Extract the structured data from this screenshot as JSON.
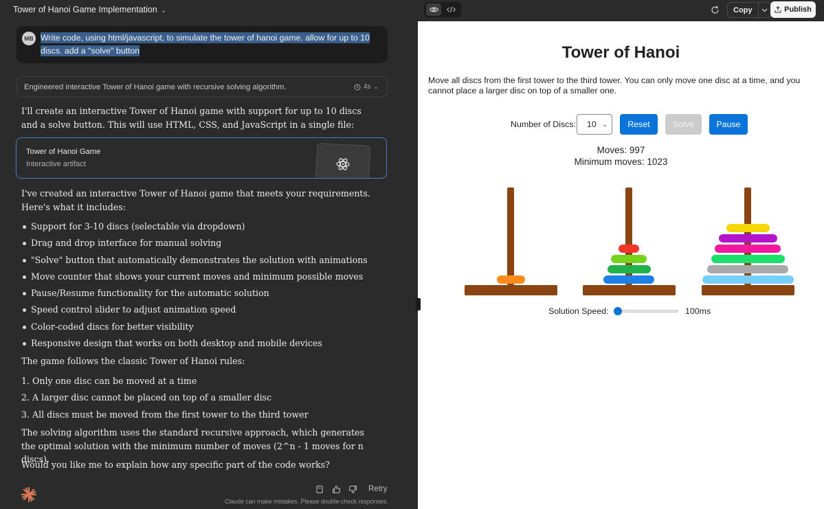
{
  "chat": {
    "title": "Tower of Hanoi Game Implementation",
    "user": {
      "initials": "MB",
      "message": "Write code, using html/javascript, to simulate the tower of hanoi game. allow for up to 10 discs. add a \"solve\" button"
    },
    "thinking": {
      "summary": "Engineered interactive Tower of Hanoi game with recursive solving algorithm.",
      "duration": "4s"
    },
    "intro": "I'll create an interactive Tower of Hanoi game with support for up to 10 discs and a solve button. This will use HTML, CSS, and JavaScript in a single file:",
    "artifact": {
      "title": "Tower of Hanoi Game",
      "subtitle": "Interactive artifact",
      "icon": "atom-icon"
    },
    "created": "I've created an interactive Tower of Hanoi game that meets your requirements. Here's what it includes:",
    "features": [
      "Support for 3-10 discs (selectable via dropdown)",
      "Drag and drop interface for manual solving",
      "\"Solve\" button that automatically demonstrates the solution with animations",
      "Move counter that shows your current moves and minimum possible moves",
      "Pause/Resume functionality for the automatic solution",
      "Speed control slider to adjust animation speed",
      "Color-coded discs for better visibility",
      "Responsive design that works on both desktop and mobile devices"
    ],
    "rules_intro": "The game follows the classic Tower of Hanoi rules:",
    "rules": [
      "1. Only one disc can be moved at a time",
      "2. A larger disc cannot be placed on top of a smaller disc",
      "3. All discs must be moved from the first tower to the third tower"
    ],
    "algorithm": "The solving algorithm uses the standard recursive approach, which generates the optimal solution with the minimum number of moves (2^n - 1 moves for n discs).",
    "question": "Would you like me to explain how any specific part of the code works?",
    "actions": {
      "retry": "Retry"
    },
    "disclaimer": "Claude can make mistakes. Please double-check responses."
  },
  "toolbar": {
    "copy": "Copy",
    "publish": "Publish"
  },
  "game": {
    "title": "Tower of Hanoi",
    "description": "Move all discs from the first tower to the third tower. You can only move one disc at a time, and you cannot place a larger disc on top of a smaller one.",
    "disc_label": "Number of Discs:",
    "disc_count": "10",
    "reset": "Reset",
    "solve": "Solve",
    "pause": "Pause",
    "moves_text": "Moves: 997",
    "min_moves_text": "Minimum moves: 1023",
    "speed_label": "Solution Speed:",
    "speed_value": "100ms",
    "speed_fraction": 0,
    "towers": [
      {
        "discs": [
          {
            "size": 2,
            "color": "#ff8c1a"
          }
        ]
      },
      {
        "discs": [
          {
            "size": 5,
            "color": "#1e80e6"
          },
          {
            "size": 4,
            "color": "#22b24c"
          },
          {
            "size": 3,
            "color": "#76d21b"
          },
          {
            "size": 1,
            "color": "#f2352b"
          }
        ]
      },
      {
        "discs": [
          {
            "size": 10,
            "color": "#78d0fa"
          },
          {
            "size": 9,
            "color": "#a9a9a9"
          },
          {
            "size": 8,
            "color": "#19e06a"
          },
          {
            "size": 7,
            "color": "#f219a1"
          },
          {
            "size": 6,
            "color": "#b313c9"
          },
          {
            "size": 4,
            "color": "#f8d706"
          }
        ]
      }
    ],
    "colors": {
      "accent": "#0a74da",
      "disabled": "#cccccc",
      "wood": "#8b4513"
    }
  }
}
